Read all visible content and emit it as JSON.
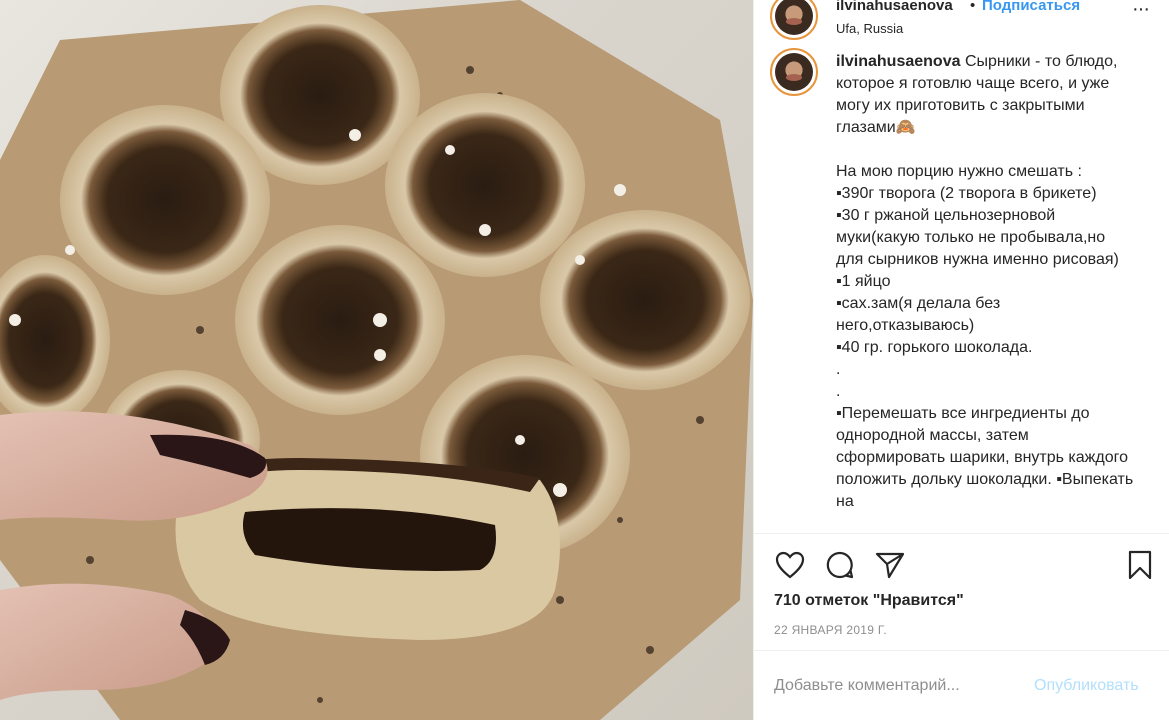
{
  "header": {
    "username": "ilvinahusaenova",
    "separator": "•",
    "follow_label": "Подписаться",
    "location": "Ufa, Russia",
    "more_icon": "more-horizontal-icon"
  },
  "caption": {
    "username": "ilvinahusaenova",
    "text": " Сырники - то блюдо, которое я готовлю чаще всего, и уже могу их приготовить с закрытыми глазами🙈\n\nНа мою порцию нужно смешать :\n▪390г творога (2 творога в брикете)\n▪30 г ржаной цельнозерновой муки(какую только не пробывала,но для сырников нужна именно рисовая)\n▪1 яйцо\n▪сах.зам(я делала без него,отказываюсь)\n▪40 гр. горького шоколада.\n.\n.\n▪Перемешать все ингредиенты до однородной массы, затем сформировать шарики, внутрь каждого положить дольку шоколадки. ▪Выпекать на"
  },
  "actions": {
    "like_icon": "heart-icon",
    "comment_icon": "comment-icon",
    "share_icon": "share-icon",
    "save_icon": "bookmark-icon",
    "likes_text": "710 отметок \"Нравится\"",
    "date": "22 ЯНВАРЯ 2019 Г."
  },
  "comment_box": {
    "placeholder": "Добавьте комментарий...",
    "publish_label": "Опубликовать"
  },
  "colors": {
    "link_blue": "#3897f0",
    "publish_disabled": "#b2dffc",
    "meta_gray": "#8e8e8e"
  }
}
